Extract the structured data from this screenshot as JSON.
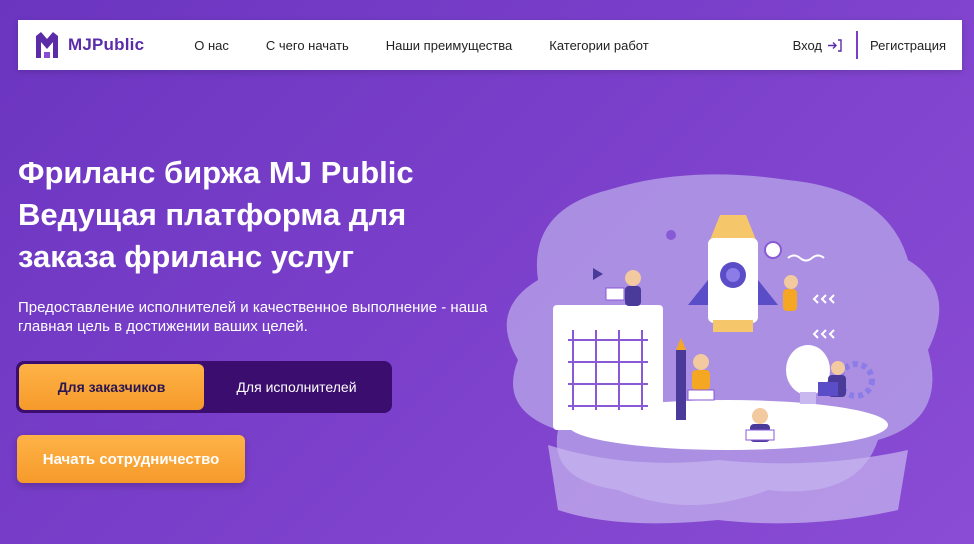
{
  "header": {
    "logo_text": "MJPublic",
    "nav": [
      {
        "label": "О нас"
      },
      {
        "label": "С чего начать"
      },
      {
        "label": "Наши преимущества"
      },
      {
        "label": "Категории работ"
      }
    ],
    "login_label": "Вход",
    "register_label": "Регистрация"
  },
  "hero": {
    "title_line1": "Фриланс биржа MJ Public",
    "title_line2": "Ведущая платформа для",
    "title_line3": "заказа фриланс услуг",
    "subtitle": "Предоставление исполнителей и качественное выполнение - наша главная цель в достижении ваших целей.",
    "toggle_customers": "Для заказчиков",
    "toggle_freelancers": "Для исполнителей",
    "cta_label": "Начать сотрудничество"
  },
  "colors": {
    "brand": "#5b2ca8",
    "accent_orange": "#f59a2a",
    "background": "#7a3fca",
    "toggle_bg": "#3a0d6e"
  },
  "icons": [
    "logo-mark-icon",
    "login-arrow-icon"
  ]
}
